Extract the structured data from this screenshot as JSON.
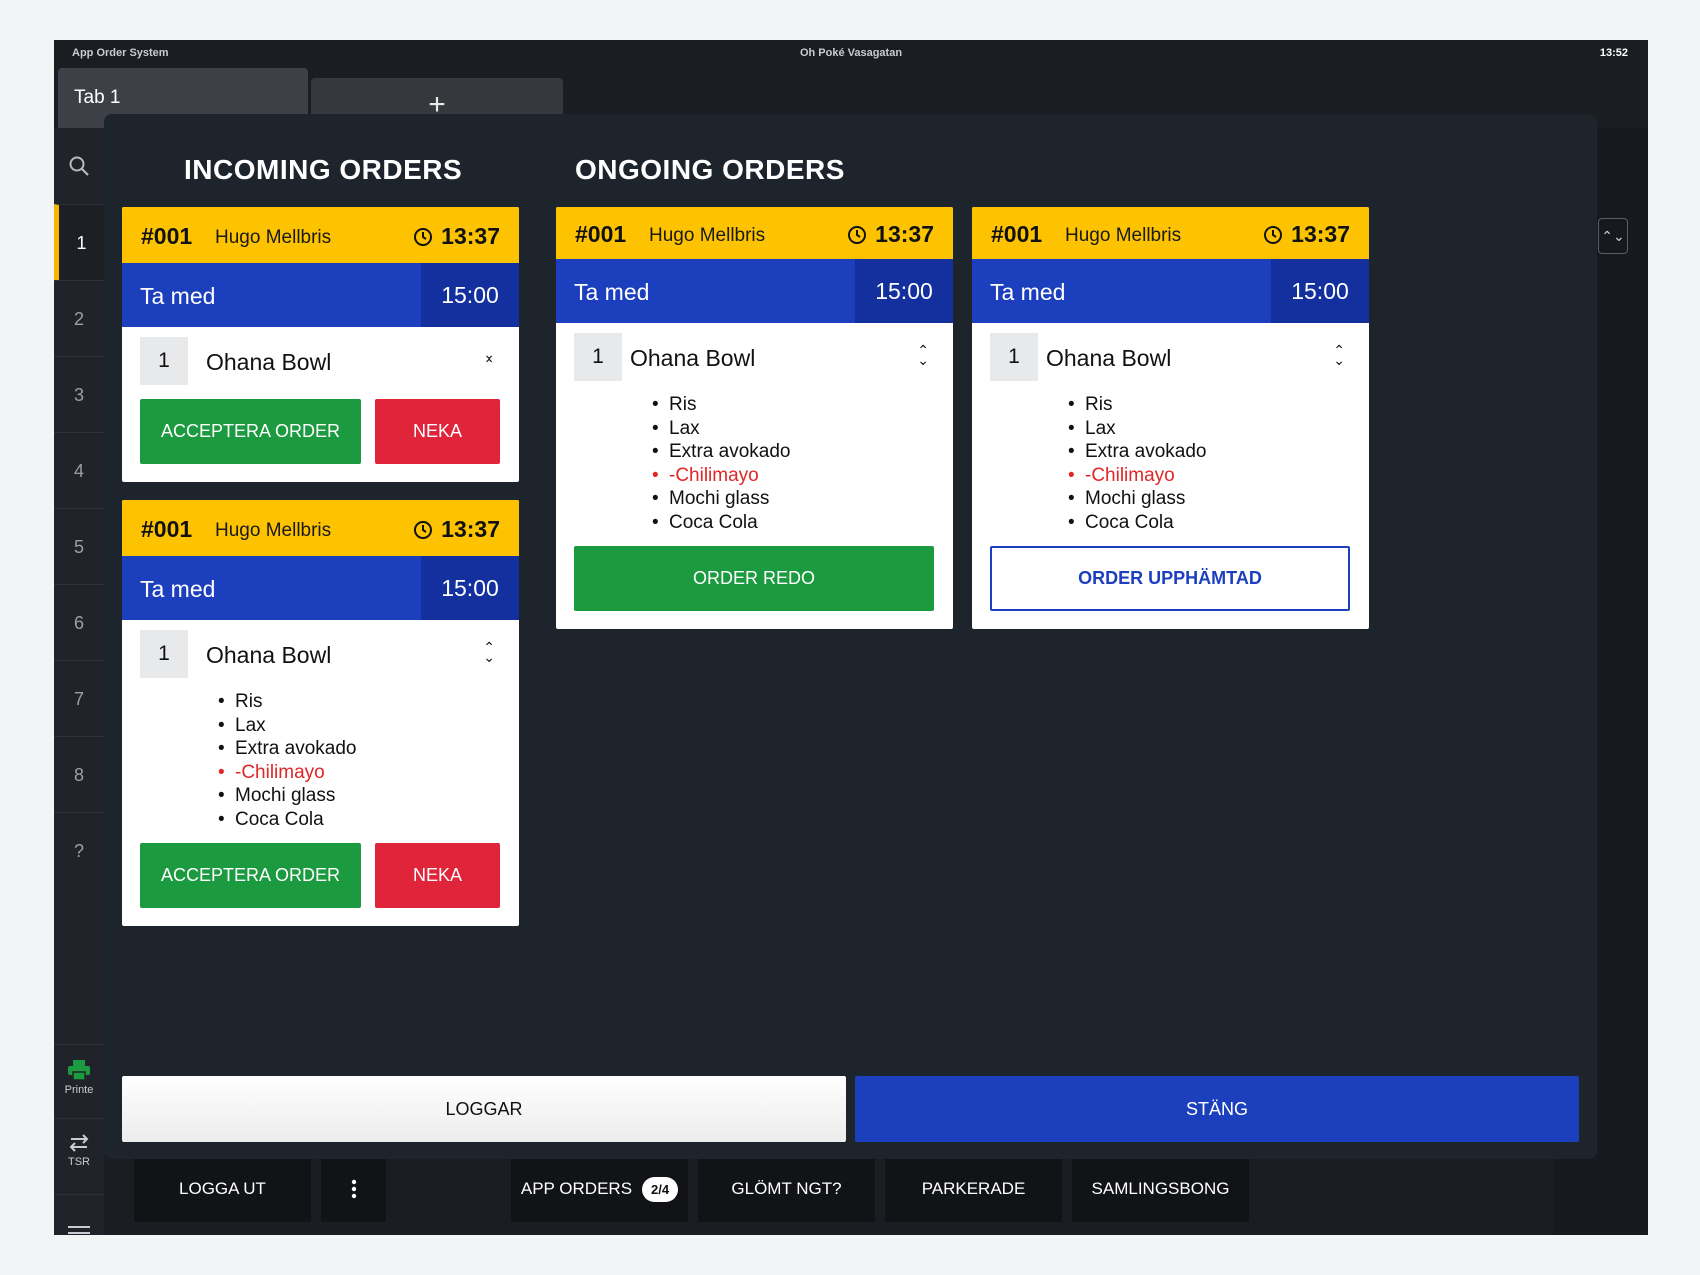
{
  "status_bar": {
    "app_name": "App Order System",
    "location": "Oh Poké Vasagatan",
    "time": "13:52"
  },
  "tabs": [
    {
      "label": "Tab 1"
    }
  ],
  "add_tab_label": "+",
  "sidebar": {
    "tables": [
      "1",
      "2",
      "3",
      "4",
      "5",
      "6",
      "7",
      "8",
      "?"
    ],
    "active_table": "1",
    "tools": [
      {
        "label": "Printe",
        "icon": "printer-icon"
      },
      {
        "label": "TSR",
        "icon": "swap-icon"
      }
    ]
  },
  "modal": {
    "incoming_title": "INCOMING ORDERS",
    "ongoing_title": "ONGOING ORDERS",
    "incoming": [
      {
        "number": "#001",
        "customer": "Hugo Mellbris",
        "time": "13:37",
        "type": "Ta med",
        "pickup": "15:00",
        "item": {
          "qty": "1",
          "name": "Ohana Bowl"
        },
        "accept_label": "ACCEPTERA ORDER",
        "reject_label": "NEKA"
      },
      {
        "number": "#001",
        "customer": "Hugo Mellbris",
        "time": "13:37",
        "type": "Ta med",
        "pickup": "15:00",
        "item": {
          "qty": "1",
          "name": "Ohana Bowl"
        },
        "mods": [
          "Ris",
          "Lax",
          "Extra avokado",
          "-Chilimayo",
          "Mochi glass",
          "Coca Cola"
        ],
        "accept_label": "ACCEPTERA ORDER",
        "reject_label": "NEKA"
      }
    ],
    "ongoing": [
      {
        "number": "#001",
        "customer": "Hugo Mellbris",
        "time": "13:37",
        "type": "Ta med",
        "pickup": "15:00",
        "item": {
          "qty": "1",
          "name": "Ohana Bowl"
        },
        "mods": [
          "Ris",
          "Lax",
          "Extra avokado",
          "-Chilimayo",
          "Mochi glass",
          "Coca Cola"
        ],
        "action_label": "ORDER REDO"
      },
      {
        "number": "#001",
        "customer": "Hugo Mellbris",
        "time": "13:37",
        "type": "Ta med",
        "pickup": "15:00",
        "item": {
          "qty": "1",
          "name": "Ohana Bowl"
        },
        "mods": [
          "Ris",
          "Lax",
          "Extra avokado",
          "-Chilimayo",
          "Mochi glass",
          "Coca Cola"
        ],
        "action_label": "ORDER UPPHÄMTAD"
      }
    ],
    "logs_label": "LOGGAR",
    "close_label": "STÄNG"
  },
  "bottom_bar": {
    "logout": "LOGGA UT",
    "app_orders": "APP ORDERS",
    "app_orders_badge": "2/4",
    "forgot": "GLÖMT NGT?",
    "parked": "PARKERADE",
    "collective": "SAMLINGSBONG"
  },
  "colors": {
    "accent_yellow": "#fdc300",
    "accent_blue": "#1c3fbe",
    "accept_green": "#1c9a3f",
    "reject_red": "#e0243a",
    "modifier_removed": "#e02626"
  }
}
